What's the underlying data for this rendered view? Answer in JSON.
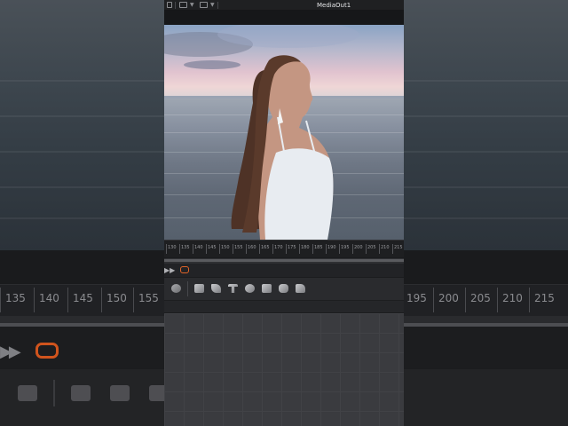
{
  "viewer": {
    "title": "MediaOut1"
  },
  "timeline": {
    "ruler_labels": [
      "130",
      "135",
      "140",
      "145",
      "150",
      "155",
      "160",
      "165",
      "170",
      "175",
      "180",
      "185",
      "190",
      "195",
      "200",
      "205",
      "210",
      "215"
    ]
  },
  "background_timeline": {
    "ruler_labels": [
      "135",
      "140",
      "145",
      "150",
      "155",
      "195",
      "200",
      "205",
      "210",
      "215"
    ]
  },
  "transport": {
    "play_icon": "fast-forward-icon",
    "loop_icon": "loop-icon",
    "loop_color": "#e06428"
  },
  "toolbar": {
    "tools": [
      "particles-icon",
      "cube-icon",
      "multiple-shapes-icon",
      "text-3d-icon",
      "sphere-icon",
      "box-3d-icon",
      "render-icon",
      "camera-icon"
    ]
  },
  "colors": {
    "panel_bg": "#28292c",
    "node_graph_bg": "#3a3b3f",
    "accent_orange": "#e06428"
  }
}
